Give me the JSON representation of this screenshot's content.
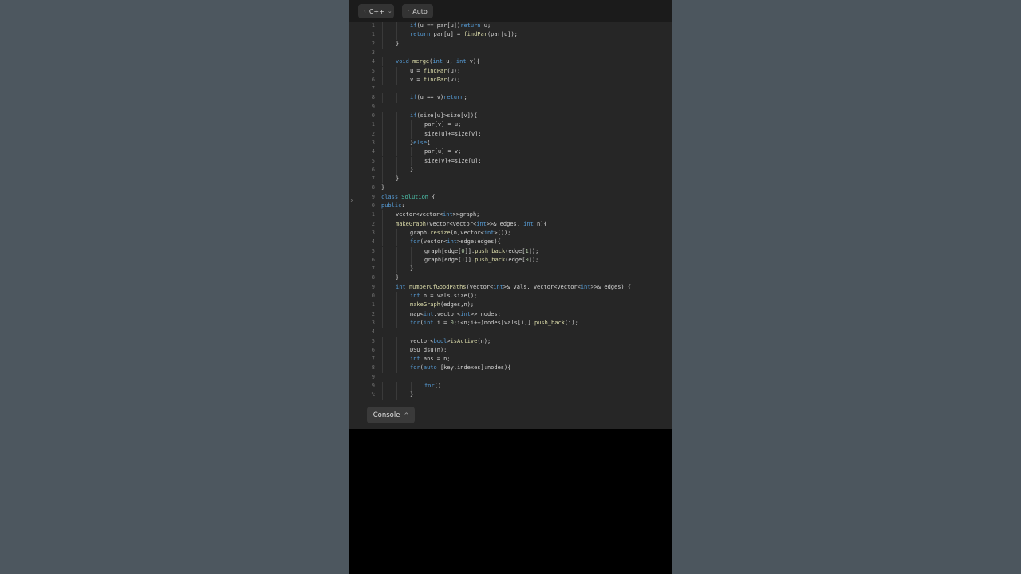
{
  "toolbar": {
    "language_label": "C++",
    "mode_label": "Auto"
  },
  "console": {
    "label": "Console"
  },
  "code_lines": [
    {
      "n": "1",
      "indent": 2,
      "text": "if(u == par[u])return u;"
    },
    {
      "n": "1",
      "indent": 2,
      "text": "return par[u] = findPar(par[u]);"
    },
    {
      "n": "2",
      "indent": 1,
      "text": "}"
    },
    {
      "n": "3",
      "indent": 0,
      "text": ""
    },
    {
      "n": "4",
      "indent": 1,
      "text": "void merge(int u, int v){"
    },
    {
      "n": "5",
      "indent": 2,
      "text": "u = findPar(u);"
    },
    {
      "n": "6",
      "indent": 2,
      "text": "v = findPar(v);"
    },
    {
      "n": "7",
      "indent": 0,
      "text": ""
    },
    {
      "n": "8",
      "indent": 2,
      "text": "if(u == v)return;"
    },
    {
      "n": "9",
      "indent": 0,
      "text": ""
    },
    {
      "n": "0",
      "indent": 2,
      "text": "if(size[u]>size[v]){"
    },
    {
      "n": "1",
      "indent": 3,
      "text": "par[v] = u;"
    },
    {
      "n": "2",
      "indent": 3,
      "text": "size[u]+=size[v];"
    },
    {
      "n": "3",
      "indent": 2,
      "text": "}else{"
    },
    {
      "n": "4",
      "indent": 3,
      "text": "par[u] = v;"
    },
    {
      "n": "5",
      "indent": 3,
      "text": "size[v]+=size[u];"
    },
    {
      "n": "6",
      "indent": 2,
      "text": "}"
    },
    {
      "n": "7",
      "indent": 1,
      "text": "}"
    },
    {
      "n": "8",
      "indent": 0,
      "text": "}"
    },
    {
      "n": "9",
      "indent": 0,
      "text": "class Solution {"
    },
    {
      "n": "0",
      "indent": 0,
      "text": "public:"
    },
    {
      "n": "1",
      "indent": 1,
      "text": "vector<vector<int>>graph;"
    },
    {
      "n": "2",
      "indent": 1,
      "text": "makeGraph(vector<vector<int>>& edges, int n){"
    },
    {
      "n": "3",
      "indent": 2,
      "text": "graph.resize(n,vector<int>());"
    },
    {
      "n": "4",
      "indent": 2,
      "text": "for(vector<int>edge:edges){"
    },
    {
      "n": "5",
      "indent": 3,
      "text": "graph[edge[0]].push_back(edge[1]);"
    },
    {
      "n": "6",
      "indent": 3,
      "text": "graph[edge[1]].push_back(edge[0]);"
    },
    {
      "n": "7",
      "indent": 2,
      "text": "}"
    },
    {
      "n": "8",
      "indent": 1,
      "text": "}"
    },
    {
      "n": "9",
      "indent": 1,
      "text": "int numberOfGoodPaths(vector<int>& vals, vector<vector<int>>& edges) {"
    },
    {
      "n": "0",
      "indent": 2,
      "text": "int n = vals.size();"
    },
    {
      "n": "1",
      "indent": 2,
      "text": "makeGraph(edges,n);"
    },
    {
      "n": "2",
      "indent": 2,
      "text": "map<int,vector<int>> nodes;"
    },
    {
      "n": "3",
      "indent": 2,
      "text": "for(int i = 0;i<n;i++)nodes[vals[i]].push_back(i);"
    },
    {
      "n": "4",
      "indent": 0,
      "text": ""
    },
    {
      "n": "5",
      "indent": 2,
      "text": "vector<bool>isActive(n);"
    },
    {
      "n": "6",
      "indent": 2,
      "text": "DSU dsu(n);"
    },
    {
      "n": "7",
      "indent": 2,
      "text": "int ans = n;"
    },
    {
      "n": "8",
      "indent": 2,
      "text": "for(auto [key,indexes]:nodes){"
    },
    {
      "n": "9",
      "indent": 0,
      "text": ""
    },
    {
      "n": "9",
      "indent": 3,
      "text": "for()"
    },
    {
      "n": "%",
      "indent": 2,
      "text": "}"
    }
  ]
}
